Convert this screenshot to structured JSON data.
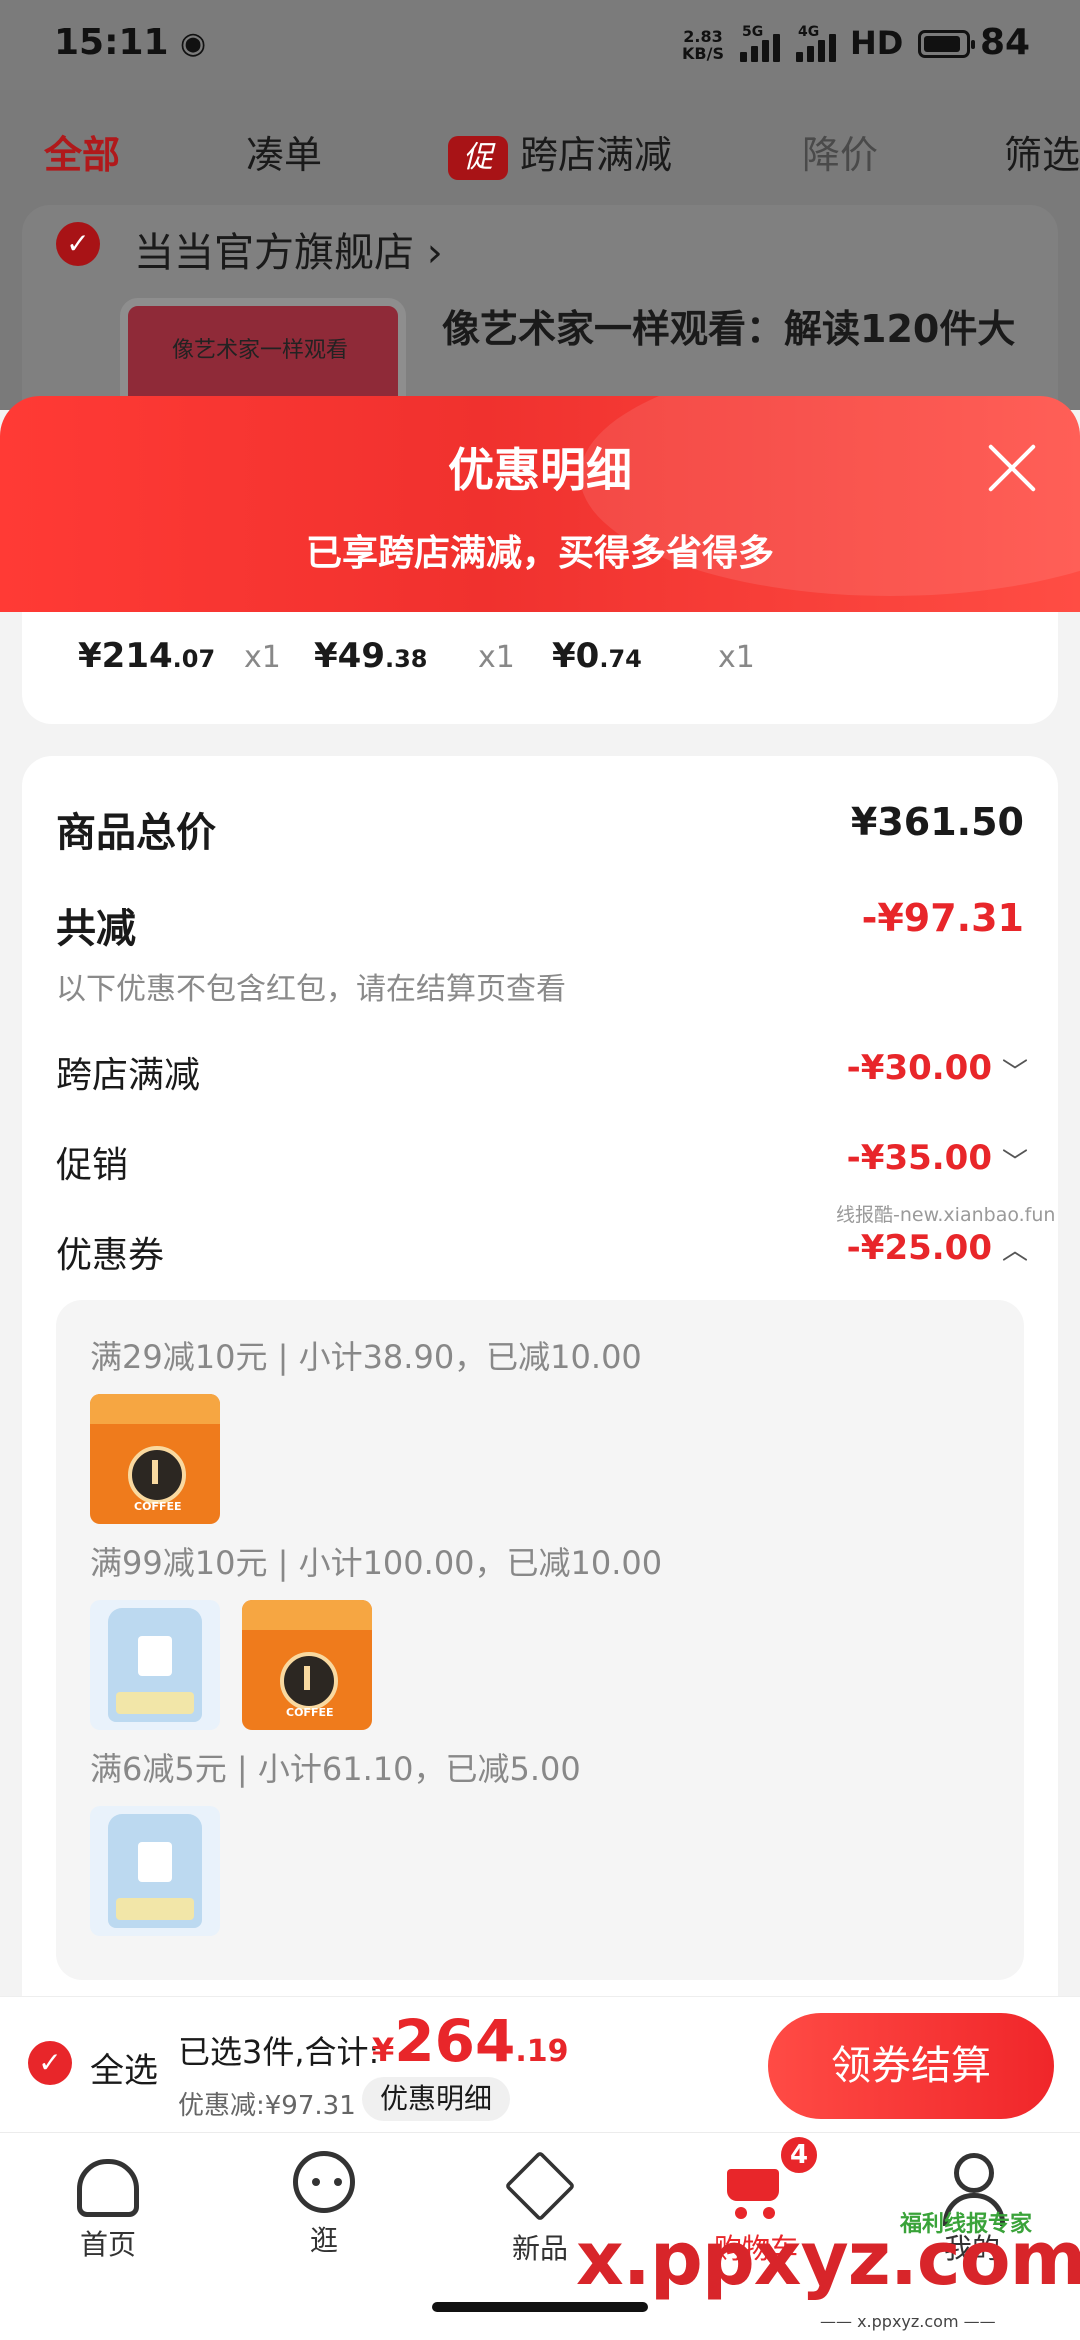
{
  "status_bar": {
    "time": "15:11",
    "net_speed_top": "2.83",
    "net_speed_bottom": "KB/S",
    "signal1": "5G",
    "signal2": "4G",
    "hd": "HD",
    "battery": "84"
  },
  "top_tabs": [
    {
      "label": "全部",
      "active": true
    },
    {
      "label": "凑单"
    },
    {
      "label": "跨店满减",
      "badge": "促"
    },
    {
      "label": "降价",
      "dim": true
    },
    {
      "label": "筛选"
    }
  ],
  "store": {
    "name": "当当官方旗舰店",
    "arrow": "›",
    "book_title": "像艺术家一样观看：解读120件大",
    "cover_text": "像艺术家一样观看"
  },
  "sheet": {
    "title": "优惠明细",
    "subtitle": "已享跨店满减，买得多省得多"
  },
  "item_prices": [
    {
      "yuan": "¥214",
      "cents": ".07",
      "qty": "x1"
    },
    {
      "yuan": "¥49",
      "cents": ".38",
      "qty": "x1"
    },
    {
      "yuan": "¥0",
      "cents": ".74",
      "qty": "x1"
    }
  ],
  "summary": {
    "goods_total_label": "商品总价",
    "goods_total_value": "¥361.50",
    "reduce_label": "共减",
    "reduce_value": "-¥97.31",
    "note": "以下优惠不包含红包，请在结算页查看",
    "rows": [
      {
        "label": "跨店满减",
        "value": "-¥30.00",
        "chevron": "﹀"
      },
      {
        "label": "促销",
        "value": "-¥35.00",
        "chevron": "﹀"
      },
      {
        "label": "优惠券",
        "value": "-¥25.00",
        "chevron": "︿"
      }
    ],
    "watermark": "线报酷-new.xianbao.fun"
  },
  "coupons": [
    {
      "text": "满29减10元 | 小计38.90，已减10.00"
    },
    {
      "text": "满99减10元 | 小计100.00，已减10.00"
    },
    {
      "text": "满6减5元 | 小计61.10，已减5.00"
    }
  ],
  "checkout": {
    "select_all": "全选",
    "selected": "已选3件,合计:",
    "currency": "¥",
    "total_big": "264",
    "total_dec": ".19",
    "saved": "优惠减:¥97.31",
    "detail": "优惠明细",
    "pay": "领券结算"
  },
  "tabbar": [
    {
      "label": "首页",
      "icon": "home-icon"
    },
    {
      "label": "逛",
      "icon": "browse-icon"
    },
    {
      "label": "新品",
      "icon": "new-box-icon"
    },
    {
      "label": "购物车",
      "icon": "cart-icon",
      "badge": "4",
      "active": true
    },
    {
      "label": "我的",
      "icon": "me-icon"
    }
  ],
  "watermarks": {
    "site": "x.ppxyz.com",
    "site_small": "—— x.ppxyz.com ——",
    "green": "福利线报专家"
  },
  "colors": {
    "accent": "#e8262a",
    "dimmed": "#7a7a7a"
  }
}
